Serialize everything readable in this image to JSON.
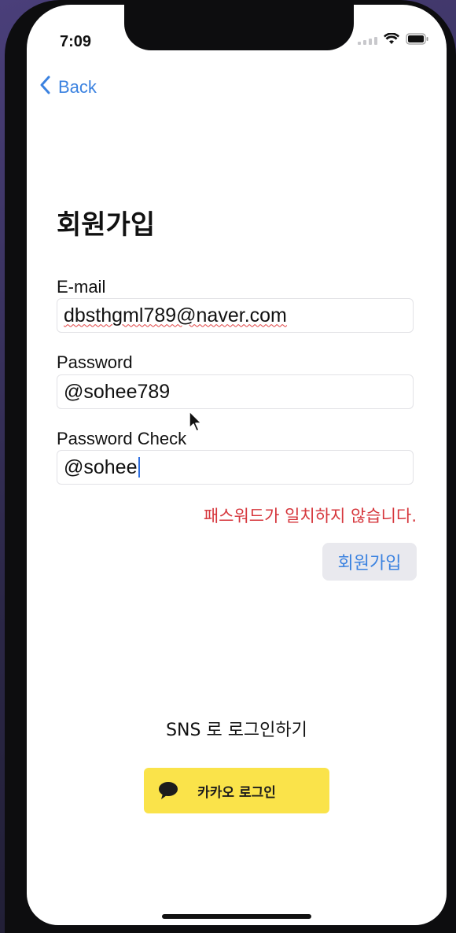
{
  "status_bar": {
    "time": "7:09",
    "icons": [
      "cellular-signal-icon",
      "wifi-icon",
      "battery-icon"
    ]
  },
  "nav": {
    "back_label": "Back",
    "back_icon": "chevron-left-icon"
  },
  "page": {
    "title": "회원가입"
  },
  "form": {
    "email": {
      "label": "E-mail",
      "value": "dbsthgml789@naver.com"
    },
    "password": {
      "label": "Password",
      "value": "@sohee789"
    },
    "password_check": {
      "label": "Password Check",
      "value": "@sohee"
    },
    "error_message": "패스워드가 일치하지 않습니다.",
    "submit_label": "회원가입"
  },
  "sns": {
    "label": "SNS 로 로그인하기",
    "kakao_label": "카카오 로그인",
    "kakao_icon": "speech-bubble-icon"
  },
  "colors": {
    "accent": "#3b82e0",
    "error": "#d6363c",
    "kakao_yellow": "#fae34a",
    "button_bg": "#e9e9ee"
  }
}
